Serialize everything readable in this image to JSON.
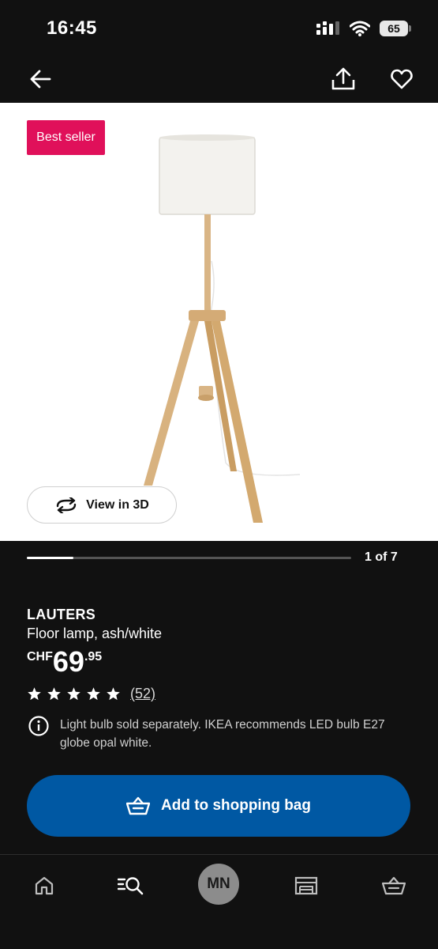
{
  "status_bar": {
    "time": "16:45",
    "battery": "65"
  },
  "product": {
    "badge": "Best seller",
    "view_3d_label": "View in 3D",
    "image_index": "1 of 7",
    "image_progress_fraction": 0.143,
    "name": "LAUTERS",
    "description": "Floor lamp, ash/white",
    "price": {
      "currency": "CHF",
      "integer": "69",
      "decimal": ".95"
    },
    "rating_stars": 5,
    "review_count": "(52)",
    "info_note": "Light bulb sold separately. IKEA recommends LED bulb E27 globe opal white."
  },
  "actions": {
    "add_to_bag_label": "Add to shopping bag"
  },
  "bottom_nav": {
    "avatar_initials": "MN",
    "tabs": [
      "home-icon",
      "search-icon",
      "avatar",
      "store-icon",
      "basket-icon"
    ]
  },
  "colors": {
    "accent": "#0058a3",
    "badge": "#e0105a",
    "background": "#111111"
  }
}
